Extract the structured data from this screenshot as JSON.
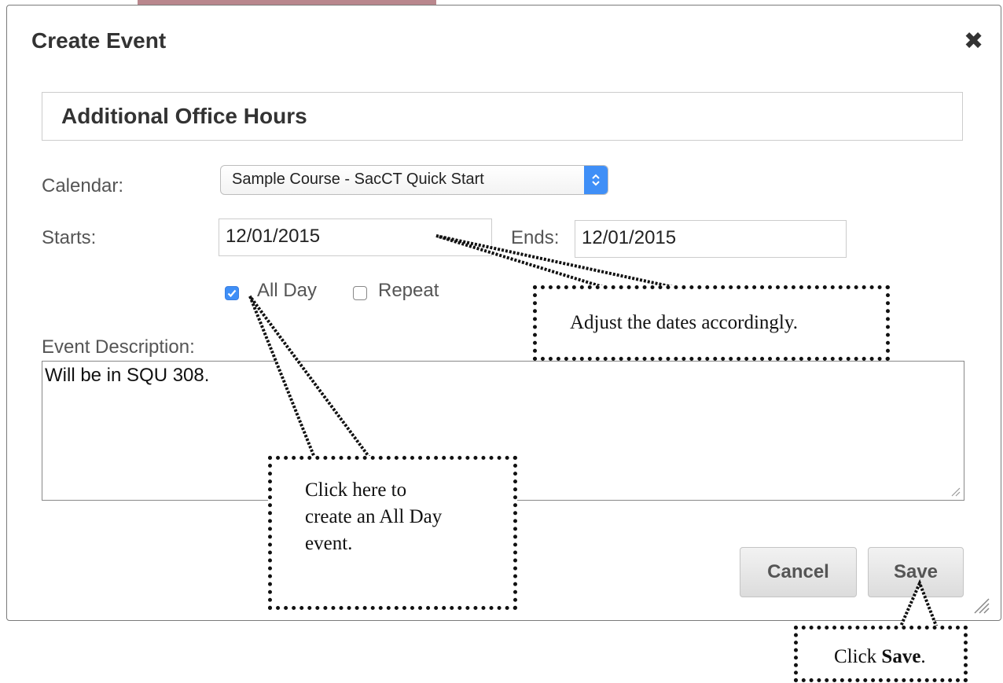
{
  "dialog": {
    "title": "Create Event",
    "close_glyph": "✖",
    "event_title": "Additional Office Hours",
    "calendar_label": "Calendar:",
    "calendar_value": "Sample Course - SacCT Quick Start",
    "starts_label": "Starts:",
    "starts_value": "12/01/2015",
    "ends_label": "Ends:",
    "ends_value": "12/01/2015",
    "all_day_label": "All Day",
    "all_day_checked": true,
    "repeat_label": "Repeat",
    "repeat_checked": false,
    "description_label": "Event Description:",
    "description_value": "Will be in SQU 308.",
    "cancel_label": "Cancel",
    "save_label": "Save"
  },
  "callouts": {
    "dates": "Adjust the dates accordingly.",
    "all_day_line1": "Click here to",
    "all_day_line2": "create an All Day",
    "all_day_line3": "event.",
    "save_prefix": "Click ",
    "save_bold": "Save",
    "save_suffix": "."
  },
  "colors": {
    "accent": "#3f8ff7",
    "text": "#333333",
    "label": "#555555"
  },
  "icons": {
    "close": "close-icon",
    "select": "select-arrows-icon",
    "checkbox": "checkmark-icon",
    "resize": "resize-grip-icon"
  }
}
